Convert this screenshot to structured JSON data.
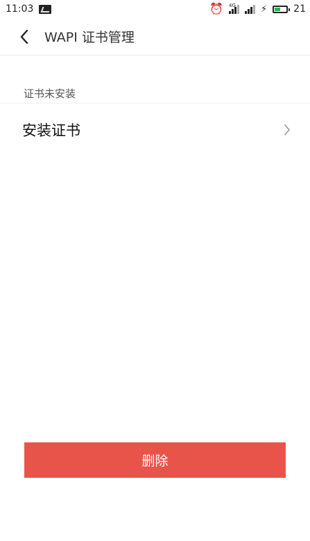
{
  "status_bar": {
    "time": "11:03",
    "battery_level": "21",
    "battery_fill_fraction": 0.21,
    "network_tag": "4G",
    "icons": [
      "image-notification-icon",
      "alarm-icon",
      "signal-4g-icon",
      "signal-icon",
      "charging-bolt-icon",
      "battery-icon"
    ]
  },
  "header": {
    "title": "WAPI 证书管理"
  },
  "section": {
    "title": "证书未安装",
    "items": [
      {
        "label": "安装证书"
      }
    ]
  },
  "actions": {
    "delete_label": "删除",
    "delete_color": "#e9544a"
  }
}
